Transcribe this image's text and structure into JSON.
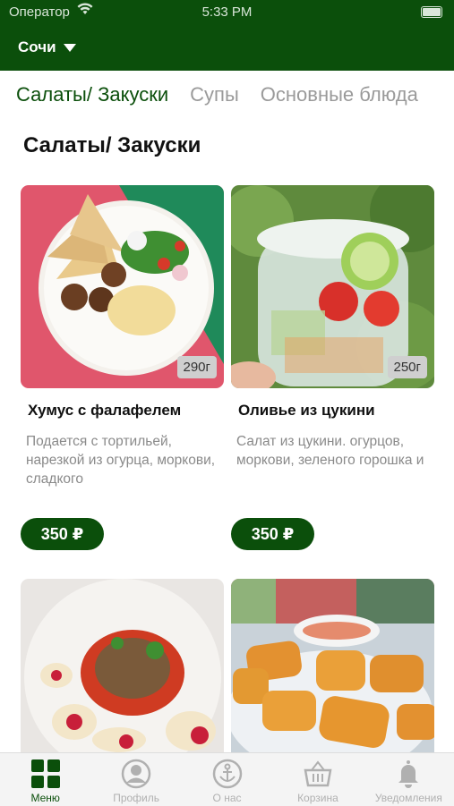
{
  "status_bar": {
    "carrier": "Оператор",
    "time": "5:33 PM"
  },
  "header": {
    "city": "Сочи"
  },
  "tabs": [
    {
      "label": "Салаты/ Закуски"
    },
    {
      "label": "Супы"
    },
    {
      "label": "Основные блюда"
    }
  ],
  "section_title": "Салаты/ Закуски",
  "products": [
    {
      "name": "Хумус с фалафелем",
      "weight": "290г",
      "description": "Подается с тортильей, нарезкой из огурца, моркови, сладкого",
      "price": "350 ₽"
    },
    {
      "name": "Оливье из цукини",
      "weight": "250г",
      "description": "Салат из цукини. огурцов, моркови, зеленого горошка и",
      "price": "350 ₽"
    }
  ],
  "bottom_nav": [
    {
      "label": "Меню",
      "icon": "grid-icon"
    },
    {
      "label": "Профиль",
      "icon": "profile-icon"
    },
    {
      "label": "О нас",
      "icon": "anchor-icon"
    },
    {
      "label": "Корзина",
      "icon": "basket-icon"
    },
    {
      "label": "Уведомления",
      "icon": "bell-icon"
    }
  ],
  "colors": {
    "brand": "#0b4f0b",
    "inactive": "#b0b0b0"
  }
}
